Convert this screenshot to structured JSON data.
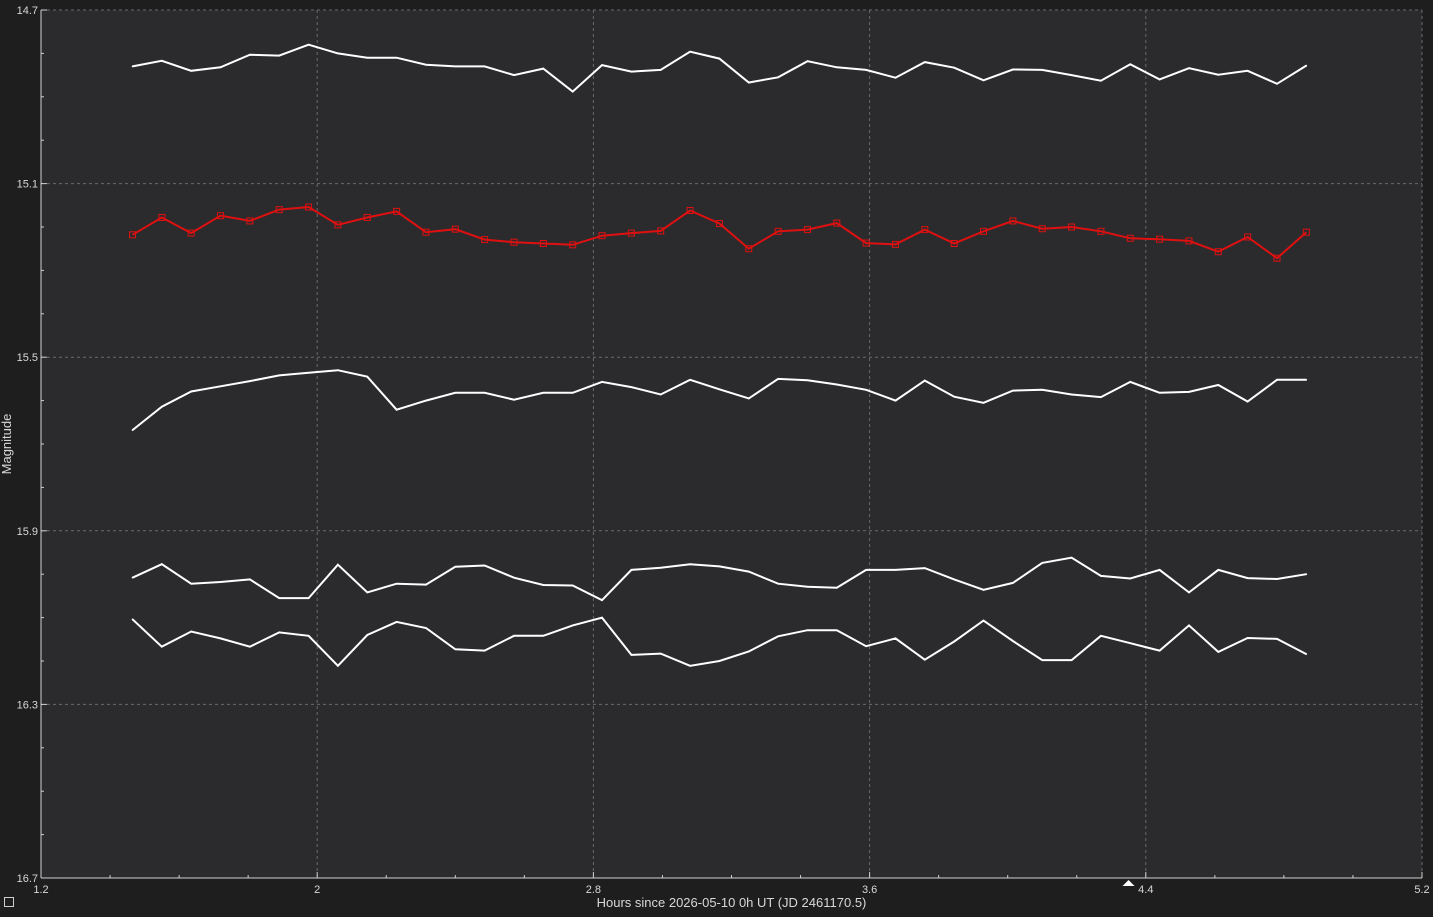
{
  "chart_data": {
    "type": "line",
    "xlabel": "Hours since 2026-05-10 0h UT (JD 2461170.5)",
    "ylabel": "Magnitude",
    "xlim": [
      1.2,
      5.2
    ],
    "ylim": [
      14.7,
      16.7
    ],
    "y_inverted": true,
    "xticks": [
      1.2,
      2,
      2.8,
      3.6,
      4.4,
      5.2
    ],
    "xtick_labels": [
      "1.2",
      "2",
      "2.8",
      "3.6",
      "4.4",
      "5.2"
    ],
    "yticks": [
      14.7,
      15.1,
      15.5,
      15.9,
      16.3,
      16.7
    ],
    "ytick_labels": [
      "14.7",
      "15.1",
      "15.5",
      "15.9",
      "16.3",
      "16.7"
    ],
    "grid": true,
    "marker_x": 4.35,
    "colors": {
      "background": "#1e1e1e",
      "plot_background": "#2b2b2d",
      "target": "#e01010",
      "comparison": "#ffffff"
    },
    "x": [
      1.465,
      1.55,
      1.635,
      1.72,
      1.805,
      1.89,
      1.975,
      2.06,
      2.145,
      2.23,
      2.315,
      2.4,
      2.485,
      2.57,
      2.655,
      2.74,
      2.825,
      2.91,
      2.995,
      3.08,
      3.165,
      3.25,
      3.335,
      3.42,
      3.505,
      3.59,
      3.675,
      3.76,
      3.845,
      3.93,
      4.015,
      4.1,
      4.185,
      4.27,
      4.355,
      4.44,
      4.525,
      4.61,
      4.695,
      4.78,
      4.865
    ],
    "series": [
      {
        "role": "comparison",
        "values": [
          14.83,
          14.817,
          14.84,
          14.832,
          14.803,
          14.805,
          14.78,
          14.8,
          14.81,
          14.81,
          14.826,
          14.83,
          14.83,
          14.85,
          14.835,
          14.888,
          14.827,
          14.842,
          14.838,
          14.796,
          14.812,
          14.867,
          14.855,
          14.818,
          14.832,
          14.838,
          14.856,
          14.82,
          14.833,
          14.862,
          14.837,
          14.838,
          14.85,
          14.863,
          14.825,
          14.86,
          14.834,
          14.849,
          14.84,
          14.87,
          14.828
        ]
      },
      {
        "role": "target",
        "values": [
          15.218,
          15.178,
          15.214,
          15.174,
          15.186,
          15.16,
          15.154,
          15.195,
          15.178,
          15.164,
          15.212,
          15.205,
          15.229,
          15.235,
          15.238,
          15.241,
          15.22,
          15.214,
          15.209,
          15.162,
          15.192,
          15.25,
          15.21,
          15.206,
          15.191,
          15.237,
          15.24,
          15.206,
          15.238,
          15.21,
          15.186,
          15.204,
          15.2,
          15.21,
          15.226,
          15.228,
          15.232,
          15.257,
          15.223,
          15.272,
          15.212
        ]
      },
      {
        "role": "comparison",
        "values": [
          15.668,
          15.614,
          15.579,
          15.567,
          15.555,
          15.542,
          15.536,
          15.53,
          15.545,
          15.621,
          15.6,
          15.582,
          15.582,
          15.598,
          15.582,
          15.582,
          15.557,
          15.569,
          15.586,
          15.552,
          15.574,
          15.595,
          15.55,
          15.553,
          15.563,
          15.575,
          15.6,
          15.554,
          15.591,
          15.605,
          15.577,
          15.575,
          15.586,
          15.592,
          15.557,
          15.582,
          15.58,
          15.564,
          15.602,
          15.552,
          15.552
        ]
      },
      {
        "role": "comparison",
        "values": [
          16.008,
          15.977,
          16.022,
          16.018,
          16.012,
          16.055,
          16.055,
          15.978,
          16.042,
          16.022,
          16.024,
          15.983,
          15.98,
          16.008,
          16.025,
          16.026,
          16.06,
          15.99,
          15.985,
          15.977,
          15.982,
          15.994,
          16.022,
          16.029,
          16.031,
          15.99,
          15.99,
          15.986,
          16.012,
          16.036,
          16.02,
          15.974,
          15.962,
          16.004,
          16.01,
          15.99,
          16.042,
          15.99,
          16.009,
          16.011,
          16.0
        ]
      },
      {
        "role": "comparison",
        "values": [
          16.104,
          16.167,
          16.132,
          16.148,
          16.167,
          16.134,
          16.142,
          16.211,
          16.14,
          16.11,
          16.124,
          16.173,
          16.176,
          16.142,
          16.142,
          16.118,
          16.1,
          16.186,
          16.183,
          16.211,
          16.2,
          16.178,
          16.143,
          16.129,
          16.129,
          16.166,
          16.148,
          16.197,
          16.155,
          16.107,
          16.154,
          16.198,
          16.198,
          16.142,
          16.159,
          16.176,
          16.118,
          16.179,
          16.147,
          16.149,
          16.184
        ]
      }
    ]
  }
}
